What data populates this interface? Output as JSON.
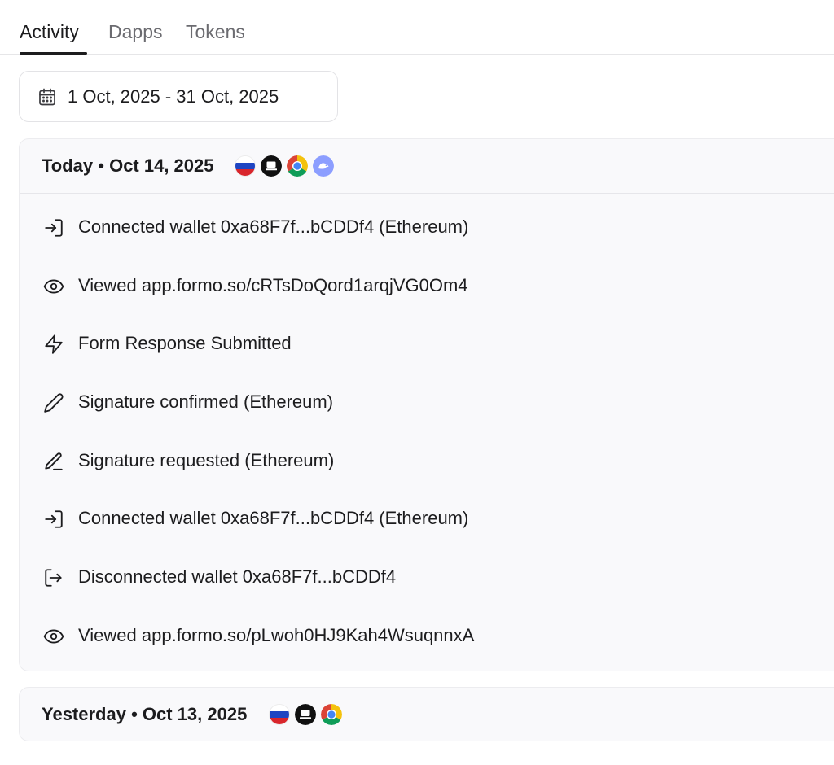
{
  "tabs": [
    {
      "label": "Activity",
      "active": true
    },
    {
      "label": "Dapps",
      "active": false
    },
    {
      "label": "Tokens",
      "active": false
    }
  ],
  "date_range": {
    "icon": "calendar-icon",
    "label": "1 Oct, 2025 - 31 Oct, 2025"
  },
  "days": [
    {
      "title": "Today • Oct 14, 2025",
      "badges": [
        "russia-flag-icon",
        "desktop-device-icon",
        "chrome-browser-icon",
        "discord-icon"
      ],
      "activities": [
        {
          "icon": "login-icon",
          "text": "Connected wallet 0xa68F7f...bCDDf4 (Ethereum)"
        },
        {
          "icon": "eye-icon",
          "text": "Viewed app.formo.so/cRTsDoQord1arqjVG0Om4"
        },
        {
          "icon": "lightning-icon",
          "text": "Form Response Submitted"
        },
        {
          "icon": "pencil-icon",
          "text": "Signature confirmed (Ethereum)"
        },
        {
          "icon": "pencil-line-icon",
          "text": "Signature requested (Ethereum)"
        },
        {
          "icon": "login-icon",
          "text": "Connected wallet 0xa68F7f...bCDDf4 (Ethereum)"
        },
        {
          "icon": "logout-icon",
          "text": "Disconnected wallet 0xa68F7f...bCDDf4"
        },
        {
          "icon": "eye-icon",
          "text": "Viewed app.formo.so/pLwoh0HJ9Kah4WsuqnnxA"
        }
      ]
    },
    {
      "title": "Yesterday • Oct 13, 2025",
      "badges": [
        "russia-flag-icon",
        "desktop-device-icon",
        "chrome-browser-icon"
      ],
      "activities": []
    }
  ],
  "colors": {
    "text": "#1c1c1e",
    "muted_tab": "#6b6b70",
    "card_bg": "#f9f9fb",
    "border": "#ececef",
    "discord": "#8c9eff",
    "chrome_red": "#db4437",
    "chrome_yellow": "#f4c20d",
    "chrome_green": "#0f9d58",
    "chrome_blue": "#4285f4"
  }
}
